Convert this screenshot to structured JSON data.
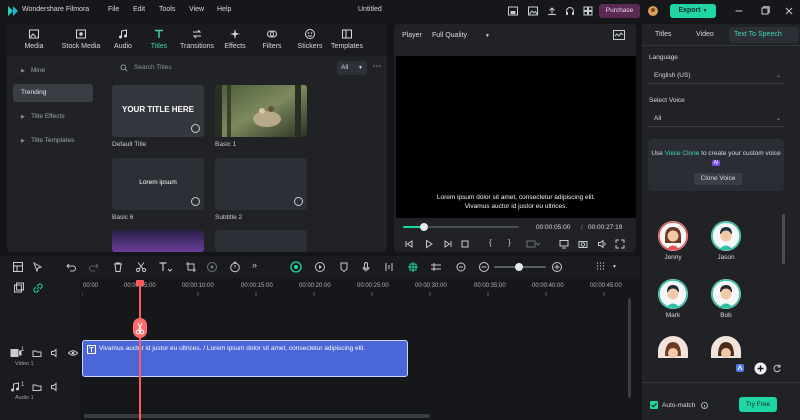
{
  "app": {
    "name": "Wondershare Filmora",
    "menu": [
      "File",
      "Edit",
      "Tools",
      "View",
      "Help"
    ],
    "document_title": "Untitled",
    "purchase_label": "Purchase",
    "export_label": "Export"
  },
  "media_tabs": [
    {
      "label": "Media",
      "icon": "media-icon"
    },
    {
      "label": "Stock Media",
      "icon": "stock-media-icon"
    },
    {
      "label": "Audio",
      "icon": "audio-icon"
    },
    {
      "label": "Titles",
      "icon": "titles-icon",
      "active": true
    },
    {
      "label": "Transitions",
      "icon": "transitions-icon"
    },
    {
      "label": "Effects",
      "icon": "effects-icon"
    },
    {
      "label": "Filters",
      "icon": "filters-icon"
    },
    {
      "label": "Stickers",
      "icon": "stickers-icon"
    },
    {
      "label": "Templates",
      "icon": "templates-icon"
    }
  ],
  "categories": [
    {
      "label": "Mine",
      "expandable": true
    },
    {
      "label": "Trending",
      "active": true
    },
    {
      "label": "Title Effects",
      "expandable": true
    },
    {
      "label": "Title Templates",
      "expandable": true
    }
  ],
  "search": {
    "placeholder": "Search Titles",
    "filter": "All"
  },
  "title_cards": [
    {
      "label": "Default Title",
      "thumb_text": "YOUR TITLE HERE"
    },
    {
      "label": "Basic 1",
      "thumb_text": ""
    },
    {
      "label": "Basic 6",
      "thumb_text": "Lorem ipsum"
    },
    {
      "label": "Subtitle 2",
      "thumb_text": ""
    }
  ],
  "player": {
    "label": "Player",
    "quality": "Full Quality",
    "caption_line1": "Lorem ipsum dolor sit amet, consectetur adipiscing elit.",
    "caption_line2": "Vivamus auctor id justor eu ultrices.",
    "current_time": "00:00:05:00",
    "total_time": "00:00:27:19",
    "progress": 0.18
  },
  "right_panel": {
    "tabs": [
      "Titles",
      "Video",
      "Text To Speech"
    ],
    "active_tab": "Text To Speech",
    "language_label": "Language",
    "language_value": "English (US)",
    "voice_label": "Select Voice",
    "voice_value": "All",
    "clone_text_pre": "Use",
    "clone_link": "Voice Clone",
    "clone_text_post": "to create your custom voice",
    "ai_badge": "AI",
    "clone_button": "Clone Voice",
    "voices": [
      "Jenny",
      "Jason",
      "Mark",
      "Bob"
    ],
    "auto_match_label": "Auto-match",
    "try_free_label": "Try Free"
  },
  "timeline": {
    "ruler_labels": [
      "00:00",
      "00:00:05:00",
      "00:00:10:00",
      "00:00:15:00",
      "00:00:20:00",
      "00:00:25:00",
      "00:00:30:00",
      "00:00:35:00",
      "00:00:40:00",
      "00:00:45:00"
    ],
    "clip_text": "Vivamus auctor id justor eu ultrices. / Lorem ipsum dolor sit amet, consectetur adipiscing elit.",
    "track_video": "Video 1",
    "track_audio": "Audio 1",
    "video_track_num": "1",
    "audio_track_num": "1"
  },
  "colors": {
    "accent": "#20d6a4",
    "clip": "#4b66d8",
    "playhead": "#ff5b5b",
    "purchase": "#5a2a55"
  }
}
